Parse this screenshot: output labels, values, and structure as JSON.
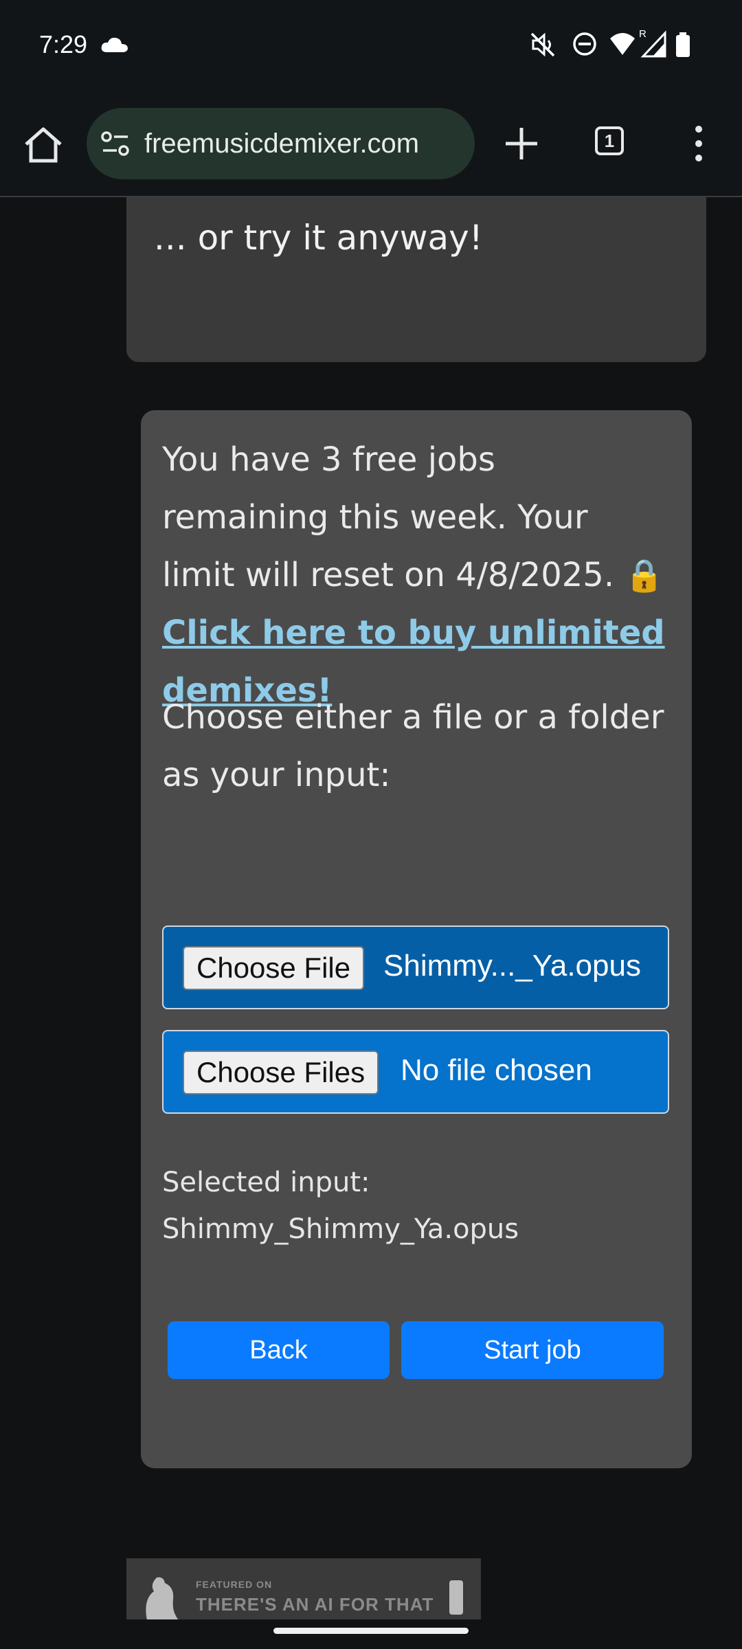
{
  "status": {
    "time": "7:29"
  },
  "browser": {
    "url": "freemusicdemixer.com",
    "tab_count": "1"
  },
  "top_card": {
    "try_text": "... or try it anyway!"
  },
  "main_card": {
    "jobs_text": "You have 3 free jobs remaining this week. Your limit will reset on 4/8/2025.",
    "lock_glyph": "🔒",
    "buy_link": "Click here to buy unlimited demixes!",
    "choose_text": "Choose either a file or a folder as your input:",
    "file_input": {
      "button_label": "Choose File",
      "value": "Shimmy..._Ya.opus"
    },
    "folder_input": {
      "button_label": "Choose Files",
      "value": "No file chosen"
    },
    "selected_label": "Selected input:",
    "selected_value": "Shimmy_Shimmy_Ya.opus",
    "back_label": "Back",
    "start_label": "Start job"
  },
  "ad": {
    "small_text": "FEATURED ON",
    "big_text": "THERE'S AN AI FOR THAT"
  },
  "colors": {
    "accent_button": "#0a7bff",
    "link": "#8ecbe8",
    "card": "#4b4b4c"
  }
}
